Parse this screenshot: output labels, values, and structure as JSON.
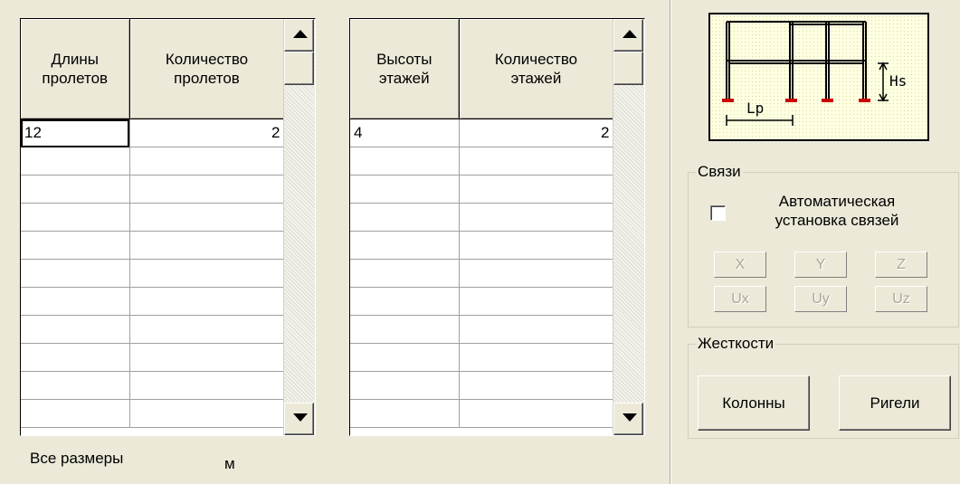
{
  "spans_table": {
    "headers": [
      "Длины\nпролетов",
      "Количество\nпролетов"
    ],
    "rows": [
      [
        "12",
        "2"
      ],
      [
        "",
        ""
      ],
      [
        "",
        ""
      ],
      [
        "",
        ""
      ],
      [
        "",
        ""
      ],
      [
        "",
        ""
      ],
      [
        "",
        ""
      ],
      [
        "",
        ""
      ],
      [
        "",
        ""
      ],
      [
        "",
        ""
      ],
      [
        "",
        ""
      ]
    ]
  },
  "floors_table": {
    "headers": [
      "Высоты\nэтажей",
      "Количество\nэтажей"
    ],
    "rows": [
      [
        "4",
        "2"
      ],
      [
        "",
        ""
      ],
      [
        "",
        ""
      ],
      [
        "",
        ""
      ],
      [
        "",
        ""
      ],
      [
        "",
        ""
      ],
      [
        "",
        ""
      ],
      [
        "",
        ""
      ],
      [
        "",
        ""
      ],
      [
        "",
        ""
      ],
      [
        "",
        ""
      ]
    ]
  },
  "footer": {
    "label": "Все размеры",
    "unit": "м"
  },
  "diagram": {
    "lp_label": "Lp",
    "hs_label": "Hs"
  },
  "links_group": {
    "title": "Связи",
    "auto_label": "Автоматическая\nустановка связей",
    "auto_checked": false,
    "buttons": [
      "X",
      "Y",
      "Z",
      "Ux",
      "Uy",
      "Uz"
    ]
  },
  "stiffness_group": {
    "title": "Жесткости",
    "columns_button": "Колонны",
    "beams_button": "Ригели"
  },
  "colors": {
    "background": "#ece9d8",
    "frame_support": "#cc0000",
    "diagram_fill": "#ffffe1"
  }
}
